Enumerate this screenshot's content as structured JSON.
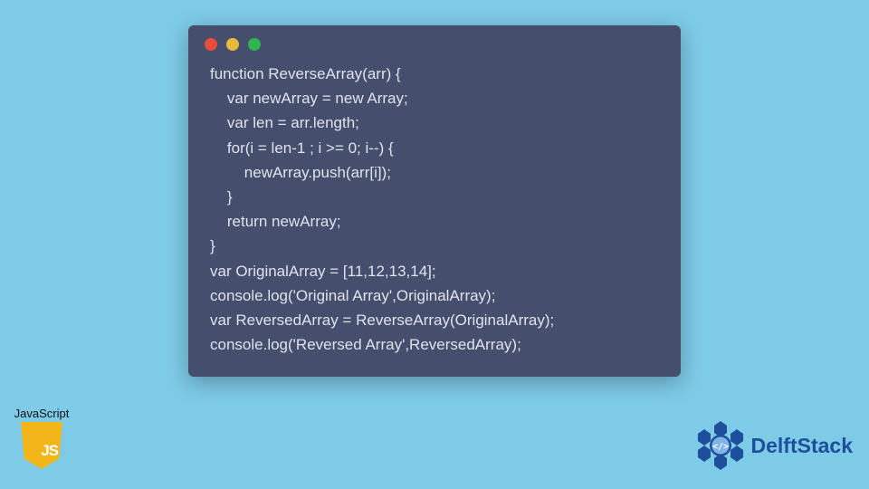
{
  "window": {
    "traffic_lights": {
      "red": "#e74c3c",
      "yellow": "#e8b83f",
      "green": "#2fb54d"
    },
    "background": "#454f6d",
    "foreground": "#dfe3ec"
  },
  "code_lines": [
    "function ReverseArray(arr) {",
    "    var newArray = new Array;",
    "    var len = arr.length;",
    "    for(i = len-1 ; i >= 0; i--) {",
    "        newArray.push(arr[i]);",
    "    }",
    "    return newArray;",
    "}",
    "var OriginalArray = [11,12,13,14];",
    "console.log('Original Array',OriginalArray);",
    "var ReversedArray = ReverseArray(OriginalArray);",
    "console.log('Reversed Array',ReversedArray);"
  ],
  "badges": {
    "javascript": {
      "label": "JavaScript",
      "icon_text": "JS"
    },
    "delftstack": {
      "label": "DelftStack"
    }
  },
  "page_background": "#7ecbe8"
}
